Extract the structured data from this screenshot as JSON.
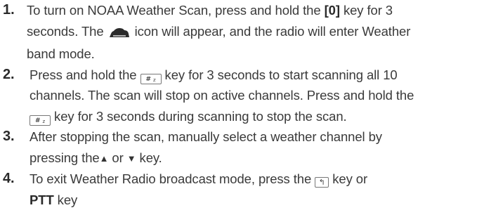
{
  "steps": [
    {
      "number": "1.",
      "text_a": "To turn on NOAA Weather Scan, press and hold the ",
      "key_a": "[0]",
      "text_b": " key for 3",
      "text_c": "seconds. The ",
      "text_d": " icon will appear, and the radio will enter Weather",
      "text_e": "band mode."
    },
    {
      "number": "2.",
      "text_a": "Press and hold the ",
      "text_b": " key for 3 seconds to start scanning all 10",
      "text_c": "channels. The scan will stop on active channels. Press and hold the",
      "text_d": "key for 3 seconds during scanning to stop the scan."
    },
    {
      "number": "3.",
      "text_a": "After stopping the scan, manually select a weather channel by",
      "text_b": "pressing the",
      "up_glyph": "▲",
      "text_c": " or ",
      "down_glyph": "▼",
      "text_d": " key."
    },
    {
      "number": "4.",
      "text_a": "To exit Weather Radio broadcast mode, press the ",
      "text_b": " key or",
      "key_b": "PTT",
      "text_c": " key"
    }
  ],
  "icons": {
    "hash_key": "hash-key-icon",
    "hash_key_symbol": "#",
    "hash_key_sub": "z",
    "back_key": "back-key-icon",
    "back_key_symbol": "↰",
    "weather": "weather-band-icon"
  }
}
